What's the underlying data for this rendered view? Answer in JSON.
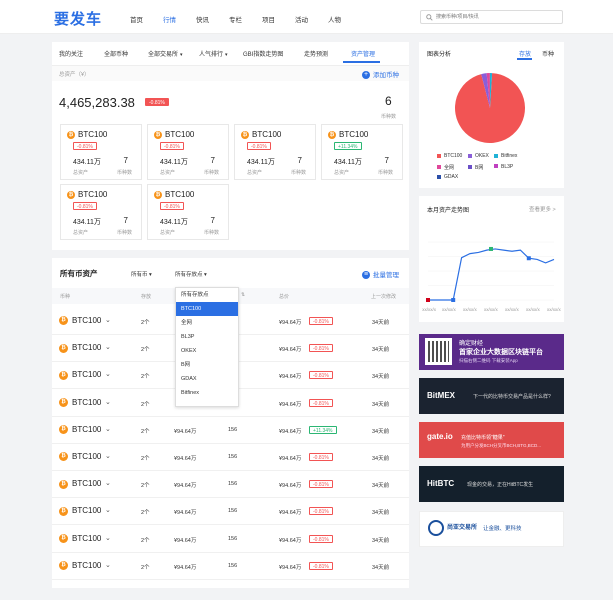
{
  "header": {
    "logo": "要发车",
    "nav": [
      "首页",
      "行情",
      "快讯",
      "专栏",
      "项目",
      "活动",
      "人物"
    ],
    "nav_active": 1,
    "search_placeholder": "搜索币种/项目/快讯"
  },
  "tabs": [
    "我的关注",
    "全部币种",
    "全部交易所",
    "人气排行",
    "GBI指数走势图",
    "走势预测",
    "资产管理"
  ],
  "tab_active": 6,
  "summary": {
    "label": "总资产（¥）",
    "add_label": "添加币种",
    "total": "4,465,283.38",
    "change": "-0.81%",
    "count": "6",
    "count_label": "币种数"
  },
  "assets": [
    {
      "name": "BTC100",
      "badge": "-0.81%",
      "badge_type": "red",
      "value": "434.11万",
      "count": "7",
      "l1": "总资产",
      "l2": "币种数"
    },
    {
      "name": "BTC100",
      "badge": "-0.81%",
      "badge_type": "red",
      "value": "434.11万",
      "count": "7",
      "l1": "总资产",
      "l2": "币种数"
    },
    {
      "name": "BTC100",
      "badge": "-0.81%",
      "badge_type": "red",
      "value": "434.11万",
      "count": "7",
      "l1": "总资产",
      "l2": "币种数"
    },
    {
      "name": "BTC100",
      "badge": "+11.34%",
      "badge_type": "green",
      "value": "434.11万",
      "count": "7",
      "l1": "总资产",
      "l2": "币种数"
    },
    {
      "name": "BTC100",
      "badge": "-0.81%",
      "badge_type": "red",
      "value": "434.11万",
      "count": "7",
      "l1": "总资产",
      "l2": "币种数"
    },
    {
      "name": "BTC100",
      "badge": "-0.81%",
      "badge_type": "red",
      "value": "434.11万",
      "count": "7",
      "l1": "总资产",
      "l2": "币种数"
    }
  ],
  "table": {
    "title": "所有币资产",
    "filter_coin": "所有币",
    "filter_point": "所有存放点",
    "manage": "批量管理",
    "headers": [
      "币种",
      "存放",
      "",
      "",
      "总价",
      "上一次修改"
    ],
    "rows": [
      {
        "name": "BTC100",
        "store": "2个",
        "price": "",
        "num": "",
        "total": "¥94.64万",
        "badge": "-0.81%",
        "badge_type": "red",
        "time": "34天前"
      },
      {
        "name": "BTC100",
        "store": "2个",
        "price": "",
        "num": "",
        "total": "¥94.64万",
        "badge": "-0.81%",
        "badge_type": "red",
        "time": "34天前"
      },
      {
        "name": "BTC100",
        "store": "2个",
        "price": "",
        "num": "",
        "total": "¥94.64万",
        "badge": "-0.81%",
        "badge_type": "red",
        "time": "34天前"
      },
      {
        "name": "BTC100",
        "store": "2个",
        "price": "",
        "num": "",
        "total": "¥94.64万",
        "badge": "-0.81%",
        "badge_type": "red",
        "time": "34天前"
      },
      {
        "name": "BTC100",
        "store": "2个",
        "price": "¥94.64万",
        "num": "156",
        "total": "¥94.64万",
        "badge": "+11.34%",
        "badge_type": "green",
        "time": "34天前"
      },
      {
        "name": "BTC100",
        "store": "2个",
        "price": "¥94.64万",
        "num": "156",
        "total": "¥94.64万",
        "badge": "-0.81%",
        "badge_type": "red",
        "time": "34天前"
      },
      {
        "name": "BTC100",
        "store": "2个",
        "price": "¥94.64万",
        "num": "156",
        "total": "¥94.64万",
        "badge": "-0.81%",
        "badge_type": "red",
        "time": "34天前"
      },
      {
        "name": "BTC100",
        "store": "2个",
        "price": "¥94.64万",
        "num": "156",
        "total": "¥94.64万",
        "badge": "-0.81%",
        "badge_type": "red",
        "time": "34天前"
      },
      {
        "name": "BTC100",
        "store": "2个",
        "price": "¥94.64万",
        "num": "156",
        "total": "¥94.64万",
        "badge": "-0.81%",
        "badge_type": "red",
        "time": "34天前"
      },
      {
        "name": "BTC100",
        "store": "2个",
        "price": "¥94.64万",
        "num": "156",
        "total": "¥94.64万",
        "badge": "-0.81%",
        "badge_type": "red",
        "time": "34天前"
      }
    ]
  },
  "dropdown": {
    "options": [
      "所有存放点",
      "BTC100",
      "全网",
      "BL3P",
      "OKEX",
      "B网",
      "GDAX",
      "Bitfinex"
    ],
    "selected": 1
  },
  "pie": {
    "title": "图表分析",
    "tabs": [
      "存放",
      "币种"
    ],
    "tab_active": 0,
    "legend": [
      {
        "name": "BTC100",
        "color": "#f25454"
      },
      {
        "name": "OKEX",
        "color": "#8a5ed8"
      },
      {
        "name": "Bitfinex",
        "color": "#20b2d6"
      },
      {
        "name": "全网",
        "color": "#e0479a"
      },
      {
        "name": "B网",
        "color": "#6a4fc7"
      },
      {
        "name": "BL3P",
        "color": "#c040c0"
      },
      {
        "name": "GDAX",
        "color": "#2b4fa8"
      }
    ]
  },
  "chart_data": {
    "type": "line",
    "title": "本月资产走势图",
    "more": "查看更多 >",
    "x": [
      "xxx/xx/x",
      "xx/xx/x",
      "xx/xx/x",
      "xx/xx/x",
      "xx/xx/x",
      "xx/xx/x",
      "xx/xx/x"
    ],
    "markers": [
      {
        "x": 0,
        "y": 0,
        "color": "#d0021b"
      },
      {
        "x": 3,
        "y": 0,
        "color": "#2b6fe3"
      },
      {
        "x": 7.5,
        "y": 0.88,
        "color": "#2bb673"
      },
      {
        "x": 12,
        "y": 0.72,
        "color": "#2b6fe3"
      }
    ],
    "values": [
      0,
      0,
      0,
      0,
      0.73,
      0.8,
      0.82,
      0.86,
      0.88,
      0.86,
      0.84,
      0.86,
      0.72,
      0.7,
      0.64,
      0.7
    ],
    "pie_values": [
      0.95,
      0.025,
      0.015,
      0.01
    ]
  },
  "ads": [
    {
      "title": "确定财经",
      "line1": "首家企业大数据区块链平台",
      "line2": "扫描右侧二维码 下载安装App",
      "bg": "#5a2a8a"
    },
    {
      "title": "BitMEX",
      "line1": "下一代的比特币交易产品是什么样?",
      "bg": "#1b2330"
    },
    {
      "title": "gate.io",
      "line1": "充值比特币领\"糖果\"",
      "line2": "为用户分发BCH分叉币BCH,BTG,BCD...",
      "bg": "#e04a4a"
    },
    {
      "title": "HitBTC",
      "line1": "现金的交易，正在HitBTC发生",
      "bg": "#14202c"
    },
    {
      "title": "尚亚交易所",
      "line1": "让金融、更科技",
      "bg": "#ffffff"
    }
  ]
}
